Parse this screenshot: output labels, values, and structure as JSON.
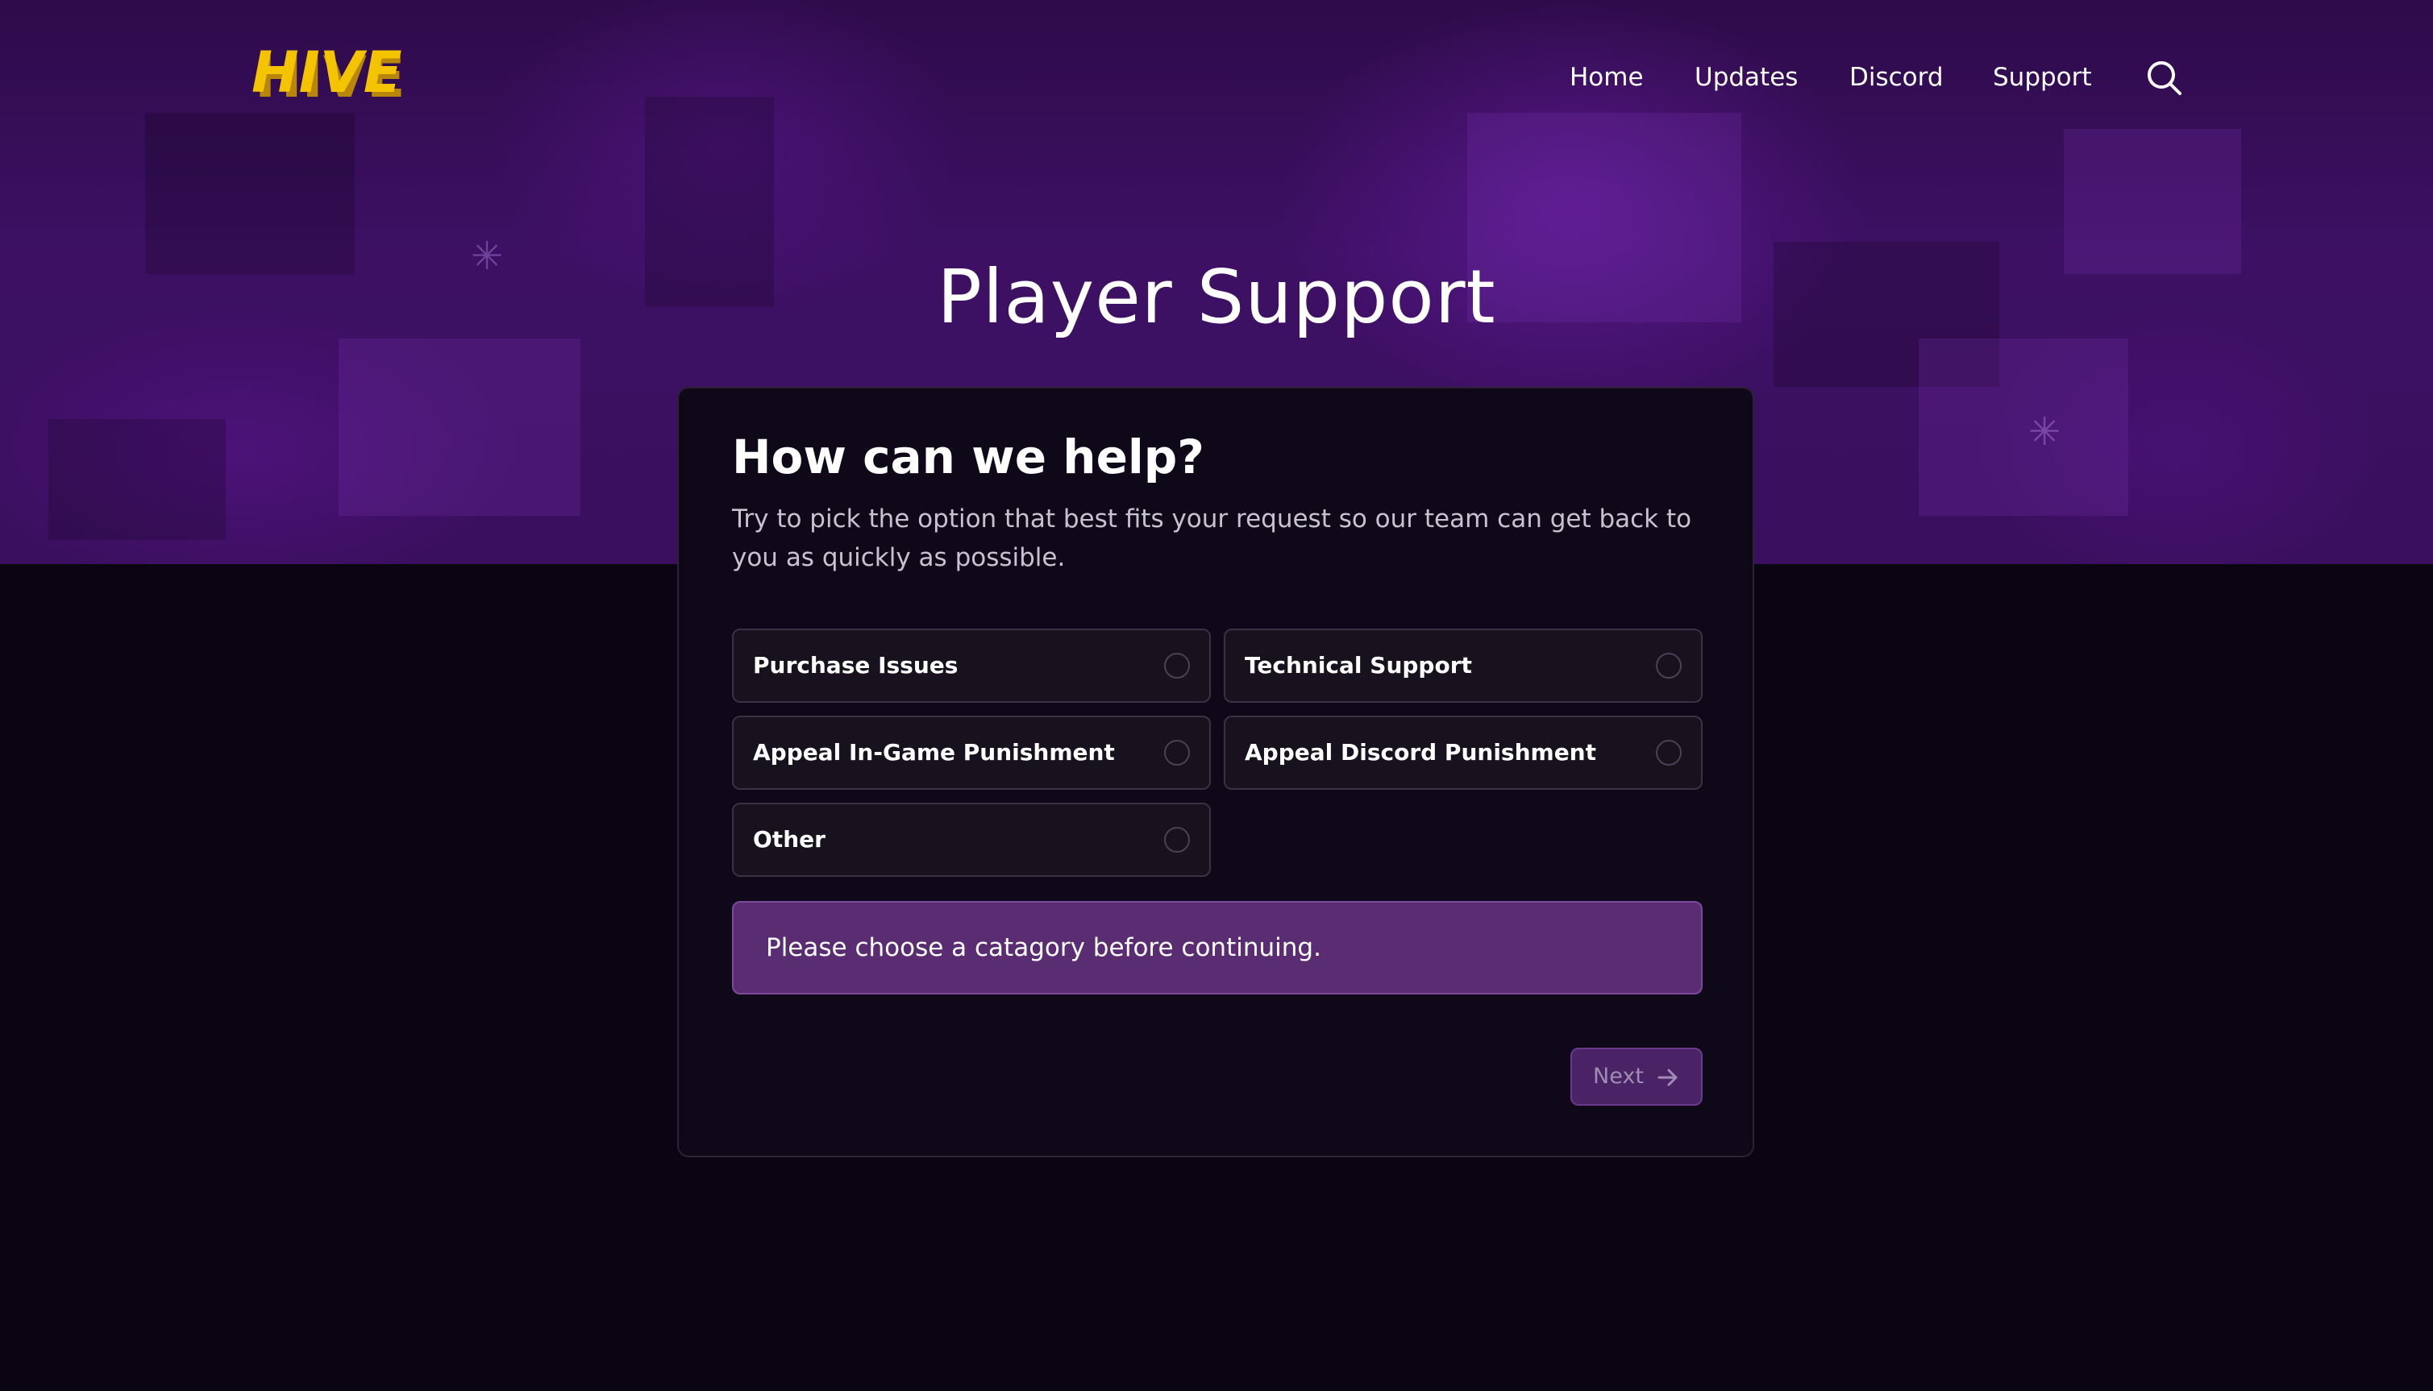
{
  "header": {
    "logo_text": "HIVE",
    "nav": [
      {
        "label": "Home"
      },
      {
        "label": "Updates"
      },
      {
        "label": "Discord"
      },
      {
        "label": "Support"
      }
    ],
    "search_icon": "search-icon"
  },
  "page": {
    "title": "Player Support"
  },
  "card": {
    "title": "How can we help?",
    "description": "Try to pick the option that best fits your request so our team can get back to you as quickly as possible.",
    "options": [
      {
        "label": "Purchase Issues",
        "selected": false
      },
      {
        "label": "Technical Support",
        "selected": false
      },
      {
        "label": "Appeal In-Game Punishment",
        "selected": false
      },
      {
        "label": "Appeal Discord Punishment",
        "selected": false
      },
      {
        "label": "Other",
        "selected": false
      }
    ],
    "alert": "Please choose a catagory before continuing.",
    "next_label": "Next",
    "next_icon": "arrow-right-icon"
  },
  "colors": {
    "hero": "#3d1064",
    "background": "#0b0413",
    "card": "#0f0818",
    "alert": "#5a2d72",
    "logo": "#f5c400",
    "button": "#4a2366"
  }
}
